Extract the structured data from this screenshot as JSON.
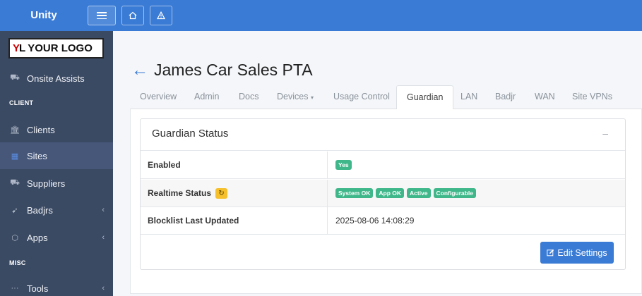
{
  "app": {
    "brand": "Unity",
    "logo_text": "YOUR LOGO",
    "logo_mark": "YL"
  },
  "colors": {
    "topbar": "#3a7bd5",
    "sidebar": "#3b4a63",
    "accent": "#3a7bd5",
    "badge_green": "#3fb78a",
    "refresh_yellow": "#f5c02c"
  },
  "topbar": {
    "icons": [
      "menu-icon",
      "home-icon",
      "warning-icon"
    ]
  },
  "sidebar": {
    "items": [
      {
        "label": "Onsite Assists",
        "icon": "truck-icon"
      },
      {
        "header": "CLIENT"
      },
      {
        "label": "Clients",
        "icon": "institution-icon"
      },
      {
        "label": "Sites",
        "icon": "building-icon",
        "active": true
      },
      {
        "label": "Suppliers",
        "icon": "truck-icon"
      },
      {
        "label": "Badjrs",
        "icon": "bird-icon",
        "expandable": true
      },
      {
        "label": "Apps",
        "icon": "cube-icon",
        "expandable": true
      },
      {
        "header": "MISC"
      },
      {
        "label": "Tools",
        "icon": "dots-icon",
        "expandable": true
      }
    ],
    "labels": {
      "onsite": "Onsite Assists",
      "client_header": "CLIENT",
      "clients": "Clients",
      "sites": "Sites",
      "suppliers": "Suppliers",
      "badjrs": "Badjrs",
      "apps": "Apps",
      "misc_header": "MISC",
      "tools": "Tools"
    }
  },
  "page": {
    "back_icon": "arrow-left-icon",
    "title": "James Car Sales PTA"
  },
  "tabs": {
    "overview": "Overview",
    "admin": "Admin",
    "docs": "Docs",
    "devices": "Devices",
    "usage": "Usage Control",
    "guardian": "Guardian",
    "lan": "LAN",
    "badjr": "Badjr",
    "wan": "WAN",
    "site_vpns": "Site VPNs",
    "active": "Guardian"
  },
  "guardian": {
    "card_title": "Guardian Status",
    "collapse_symbol": "–",
    "rows": {
      "enabled_label": "Enabled",
      "enabled_value": "Yes",
      "realtime_label": "Realtime Status",
      "realtime_badges": [
        "System OK",
        "App OK",
        "Active",
        "Configurable"
      ],
      "blocklist_label": "Blocklist Last Updated",
      "blocklist_value": "2025-08-06 14:08:29"
    },
    "edit_button": "Edit Settings"
  }
}
